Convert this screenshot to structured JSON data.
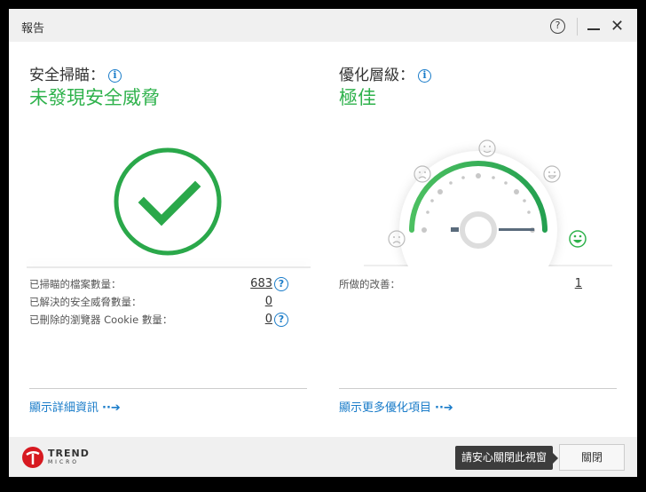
{
  "window": {
    "title": "報告",
    "help": "?"
  },
  "security": {
    "label": "安全掃瞄：",
    "status": "未發現安全威脅",
    "stats": [
      {
        "label": "已掃瞄的檔案數量：",
        "value": "683",
        "help": true
      },
      {
        "label": "已解決的安全威脅數量：",
        "value": "0",
        "help": false
      },
      {
        "label": "已刪除的瀏覽器 Cookie 數量：",
        "value": "0",
        "help": true
      }
    ],
    "link": "顯示詳細資訊"
  },
  "optimization": {
    "label": "優化層級：",
    "status": "極佳",
    "stats": [
      {
        "label": "所做的改善：",
        "value": "1"
      }
    ],
    "link": "顯示更多優化項目",
    "gauge_level": "best"
  },
  "footer": {
    "logo_text": "TREND MICRO",
    "tooltip": "請安心關閉此視窗",
    "close_label": "關閉"
  },
  "colors": {
    "green": "#2fb24c",
    "blue": "#1a7cc9"
  }
}
